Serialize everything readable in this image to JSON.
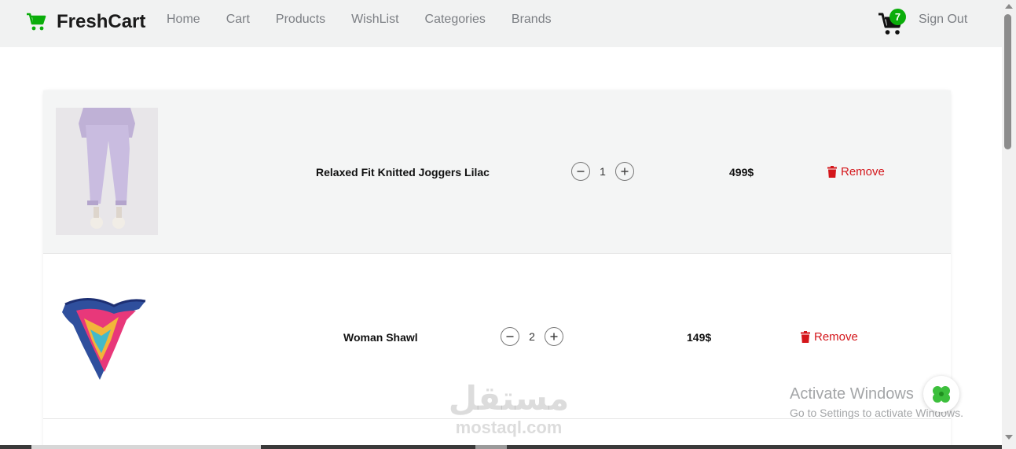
{
  "navbar": {
    "brand": "FreshCart",
    "links": [
      "Home",
      "Cart",
      "Products",
      "WishList",
      "Categories",
      "Brands"
    ],
    "cart_count": "7",
    "sign_out": "Sign Out"
  },
  "cart": {
    "items": [
      {
        "name": "Relaxed Fit Knitted Joggers Lilac",
        "quantity": "1",
        "price": "499$",
        "remove_label": "Remove"
      },
      {
        "name": "Woman Shawl",
        "quantity": "2",
        "price": "149$",
        "remove_label": "Remove"
      }
    ]
  },
  "overlay": {
    "activate_title": "Activate Windows",
    "activate_sub": "Go to Settings to activate Windows.",
    "watermark_ar": "مستقل",
    "watermark_en": "mostaql.com"
  },
  "colors": {
    "brand_green": "#0aad0a",
    "remove_red": "#d4161b",
    "nav_bg": "#f1f2f2"
  }
}
